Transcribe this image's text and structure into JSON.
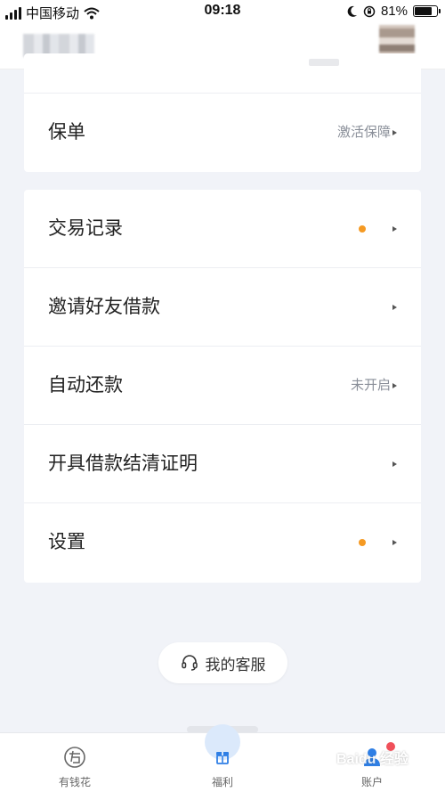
{
  "status_bar": {
    "carrier": "中国移动",
    "time": "09:18",
    "battery": "81%",
    "battery_level": 0.81
  },
  "menu_top": {
    "rows": [
      {
        "label": "保单",
        "value": "激活保障"
      }
    ]
  },
  "menu_main": {
    "rows": [
      {
        "label": "交易记录",
        "value": "",
        "dot": true
      },
      {
        "label": "邀请好友借款",
        "value": ""
      },
      {
        "label": "自动还款",
        "value": "未开启"
      },
      {
        "label": "开具借款结清证明",
        "value": ""
      },
      {
        "label": "设置",
        "value": "",
        "dot": true
      }
    ]
  },
  "service": {
    "label": "我的客服",
    "icon": "headset-icon"
  },
  "tab_bar": {
    "tabs": [
      {
        "label": "有钱花",
        "icon": "youqianhua-icon"
      },
      {
        "label": "福利",
        "icon": "gift-icon"
      },
      {
        "label": "账户",
        "icon": "user-icon"
      }
    ]
  },
  "colors": {
    "background": "#f1f3f8",
    "dot": "#f59a23",
    "accent": "#2f7fe5"
  }
}
